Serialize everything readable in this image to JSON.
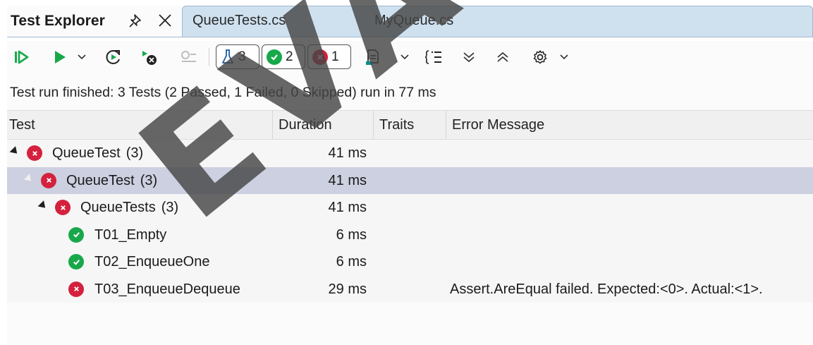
{
  "tabs": {
    "active": "Test Explorer",
    "documents": [
      "QueueTests.cs",
      "MyQueue.cs"
    ]
  },
  "toolbar": {
    "total_count": "3",
    "passed_count": "2",
    "failed_count": "1",
    "icons": [
      "run-all-icon",
      "run-icon",
      "rerun-failed-icon",
      "cancel-icon",
      "group-icon",
      "filter-icon",
      "sort-icon",
      "expand-all-icon",
      "collapse-all-icon",
      "settings-icon"
    ]
  },
  "summary": "Test run finished: 3 Tests (2 Passed, 1 Failed, 0 Skipped) run in 77 ms",
  "table": {
    "headers": [
      "Test",
      "Duration",
      "Traits",
      "Error Message"
    ],
    "rows": [
      {
        "name": "QueueTest",
        "count": "(3)",
        "duration": "41 ms",
        "status": "failed",
        "level": 0,
        "error": ""
      },
      {
        "name": "QueueTest",
        "count": "(3)",
        "duration": "41 ms",
        "status": "failed",
        "level": 1,
        "error": ""
      },
      {
        "name": "QueueTests",
        "count": "(3)",
        "duration": "41 ms",
        "status": "failed",
        "level": 2,
        "error": ""
      },
      {
        "name": "T01_Empty",
        "count": "",
        "duration": "6 ms",
        "status": "passed",
        "level": 3,
        "error": ""
      },
      {
        "name": "T02_EnqueueOne",
        "count": "",
        "duration": "6 ms",
        "status": "passed",
        "level": 3,
        "error": ""
      },
      {
        "name": "T03_EnqueueDequeue",
        "count": "",
        "duration": "29 ms",
        "status": "failed",
        "level": 3,
        "error": "Assert.AreEqual failed. Expected:<0>. Actual:<1>."
      }
    ]
  },
  "watermark": "EVAL",
  "colors": {
    "passed": "#17a84a",
    "failed": "#d4213d",
    "selected_row": "#ccd0e0",
    "accent": "#cfe1ef"
  }
}
